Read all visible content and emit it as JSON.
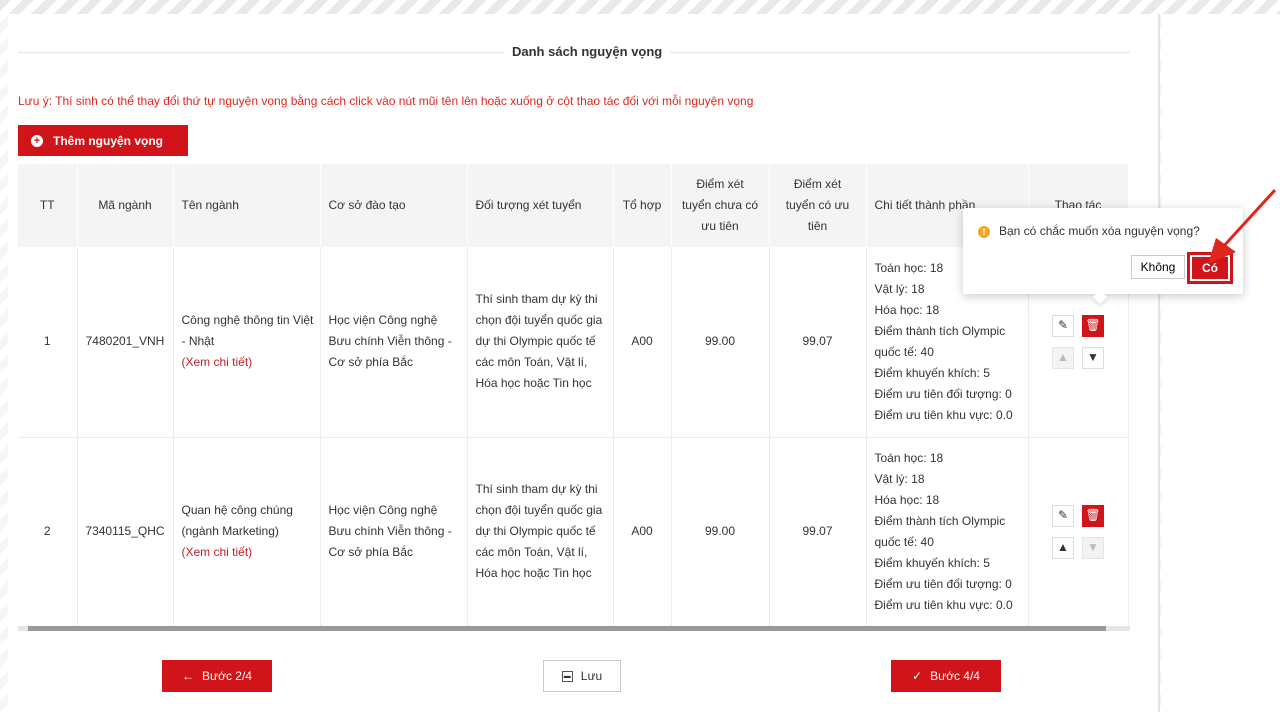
{
  "section_title": "Danh sách nguyện vọng",
  "note": "Lưu ý: Thí sinh có thể thay đổi thứ tự nguyện vọng bằng cách click vào nút mũi tên lên hoặc xuống ở cột thao tác đối với mỗi nguyện vọng",
  "add_button": "Thêm nguyện vọng",
  "table": {
    "headers": {
      "tt": "TT",
      "ma_nganh": "Mã ngành",
      "ten_nganh": "Tên ngành",
      "co_so": "Cơ sở đào tạo",
      "doi_tuong": "Đối tượng xét tuyển",
      "to_hop": "Tổ hợp",
      "diem_chua_uu_tien": "Điểm xét tuyển chưa có ưu tiên",
      "diem_co_uu_tien": "Điểm xét tuyển có ưu tiên",
      "chi_tiet": "Chi tiết thành phần",
      "thao_tac": "Thao tác"
    },
    "rows": [
      {
        "tt": "1",
        "ma_nganh": "7480201_VNH",
        "ten_nganh": "Công nghệ thông tin Việt - Nhật",
        "xem_chi_tiet": "(Xem chi tiết)",
        "co_so": "Học viện Công nghệ Bưu chính Viễn thông - Cơ sở phía Bắc",
        "doi_tuong": "Thí sinh tham dự kỳ thi chọn đội tuyển quốc gia dự thi Olympic quốc tế các môn Toán, Vật lí, Hóa học hoặc Tin học",
        "to_hop": "A00",
        "diem_chua_uu_tien": "99.00",
        "diem_co_uu_tien": "99.07",
        "chi_tiet": [
          "Toán học: 18",
          "Vật lý: 18",
          "Hóa học: 18",
          "Điểm thành tích Olympic quốc tế: 40",
          "Điểm khuyến khích: 5",
          "Điểm ưu tiên đối tượng: 0",
          "Điểm ưu tiên khu vực: 0.0"
        ]
      },
      {
        "tt": "2",
        "ma_nganh": "7340115_QHC",
        "ten_nganh": "Quan hệ công chúng (ngành Marketing)",
        "xem_chi_tiet": "(Xem chi tiết)",
        "co_so": "Học viện Công nghệ Bưu chính Viễn thông - Cơ sở phía Bắc",
        "doi_tuong": "Thí sinh tham dự kỳ thi chọn đội tuyển quốc gia dự thi Olympic quốc tế các môn Toán, Vật lí, Hóa học hoặc Tin học",
        "to_hop": "A00",
        "diem_chua_uu_tien": "99.00",
        "diem_co_uu_tien": "99.07",
        "chi_tiet": [
          "Toán học: 18",
          "Vật lý: 18",
          "Hóa học: 18",
          "Điểm thành tích Olympic quốc tế: 40",
          "Điểm khuyến khích: 5",
          "Điểm ưu tiên đối tượng: 0",
          "Điểm ưu tiên khu vực: 0.0"
        ]
      }
    ]
  },
  "popover": {
    "message": "Bạn có chắc muốn xóa nguyện vọng?",
    "no": "Không",
    "yes": "Có"
  },
  "footer": {
    "back": "Bước 2/4",
    "save": "Lưu",
    "next": "Bước 4/4"
  },
  "colors": {
    "accent": "#d0141a",
    "note": "#e0261b"
  }
}
